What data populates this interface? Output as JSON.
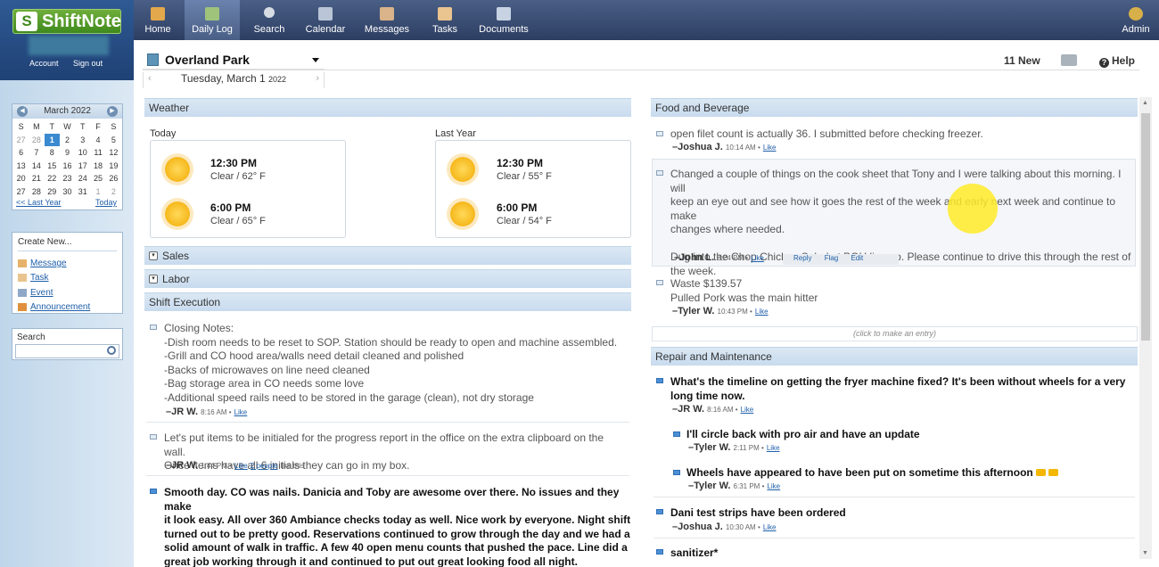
{
  "brand": {
    "name": "ShiftNote"
  },
  "account": {
    "account_label": "Account",
    "signout_label": "Sign out"
  },
  "nav": {
    "home": "Home",
    "daily_log": "Daily Log",
    "search": "Search",
    "calendar": "Calendar",
    "messages": "Messages",
    "tasks": "Tasks",
    "documents": "Documents",
    "admin": "Admin"
  },
  "calendar": {
    "month": "March 2022",
    "days": [
      "S",
      "M",
      "T",
      "W",
      "T",
      "F",
      "S"
    ],
    "weeks": [
      [
        "27",
        "28",
        "1",
        "2",
        "3",
        "4",
        "5"
      ],
      [
        "6",
        "7",
        "8",
        "9",
        "10",
        "11",
        "12"
      ],
      [
        "13",
        "14",
        "15",
        "16",
        "17",
        "18",
        "19"
      ],
      [
        "20",
        "21",
        "22",
        "23",
        "24",
        "25",
        "26"
      ],
      [
        "27",
        "28",
        "29",
        "30",
        "31",
        "1",
        "2"
      ]
    ],
    "last_year": "<< Last Year",
    "today": "Today"
  },
  "create_new": {
    "title": "Create New...",
    "items": [
      "Message",
      "Task",
      "Event",
      "Announcement"
    ]
  },
  "search": {
    "title": "Search",
    "placeholder": ""
  },
  "header": {
    "location": "Overland Park",
    "date": "Tuesday, March 1",
    "year": "2022",
    "new_count": "11 New",
    "help": "Help"
  },
  "weather": {
    "title": "Weather",
    "today_label": "Today",
    "last_year_label": "Last Year",
    "today": [
      {
        "time": "12:30 PM",
        "cond": "Clear / 62° F"
      },
      {
        "time": "6:00 PM",
        "cond": "Clear / 65° F"
      }
    ],
    "last_year": [
      {
        "time": "12:30 PM",
        "cond": "Clear / 55° F"
      },
      {
        "time": "6:00 PM",
        "cond": "Clear / 54° F"
      }
    ]
  },
  "sections": {
    "sales": "Sales",
    "labor": "Labor",
    "shift_execution": "Shift Execution",
    "food_beverage": "Food and Beverage",
    "repair": "Repair and Maintenance"
  },
  "shift_entries": [
    {
      "lines": [
        "Closing Notes:",
        "-Dish room needs to be reset to SOP. Station should be ready to open and machine assembled.",
        "-Grill and CO hood area/walls need detail cleaned and polished",
        "-Backs of microwaves on line need cleaned",
        "-Bag storage area in CO needs some love",
        "-Additional speed rails need to be stored in the garage (clean), not dry storage"
      ],
      "author": "–JR W.",
      "time": "8:16 AM •",
      "like": "Like"
    },
    {
      "lines": [
        "Let's put items to be initialed for the progress report in the office on the extra clipboard on the wall.",
        "Once items have all 6 initials they can go in my box."
      ],
      "author": "–JR W.",
      "time": "1:44 PM •",
      "like": "Like",
      "likers_link": "2 people",
      "likers_text": "like this"
    },
    {
      "lines": [
        "Smooth day. CO was nails. Danicia and Toby are awesome over there. No issues and they make",
        "it look easy. All over 360 Ambiance checks today as well. Nice work by everyone. Night shift",
        "turned out to be pretty good. Reservations continued to grow through the day and we had a",
        "solid amount of walk in traffic. A few 40 open menu counts that pushed the pace. Line did a",
        "great job working through it and continued to put out great looking food all night."
      ]
    }
  ],
  "food_entries": [
    {
      "lines": [
        "open filet count is actually 36. I submitted before checking freezer."
      ],
      "author": "–Joshua J.",
      "time": "10:14 AM •",
      "like": "Like"
    },
    {
      "lines": [
        "Changed a couple of things on the cook sheet that Tony and I were talking about this morning. I will",
        "keep an eye out and see how it goes the rest of the week and early next week and continue to make",
        "changes where needed.",
        "",
        "Dug into the Chop Chicken Salad at BOH line up. Please continue to drive this through the rest of",
        "the week."
      ],
      "author": "–John L.",
      "time": "8:24 PM •",
      "like": "Like",
      "actions": [
        "Reply",
        "Flag",
        "Edit"
      ]
    },
    {
      "lines": [
        "Waste $139.57",
        "Pulled Pork was the main hitter"
      ],
      "author": "–Tyler W.",
      "time": "10:43 PM •",
      "like": "Like"
    }
  ],
  "entry_prompt": "(click to make an entry)",
  "repair_entries": [
    {
      "lines": [
        "What's the timeline on getting the fryer machine fixed? It's been without wheels for a very",
        "long time now."
      ],
      "author": "–JR W.",
      "time": "8:16 AM •",
      "like": "Like"
    },
    {
      "lines": [
        "I'll circle back with pro air and have an update"
      ],
      "author": "–Tyler W.",
      "time": "2:11 PM •",
      "like": "Like"
    },
    {
      "lines": [
        "Wheels have appeared to have been put on sometime this afternoon"
      ],
      "author": "–Tyler W.",
      "time": "6:31 PM •",
      "like": "Like"
    },
    {
      "lines": [
        "Dani test strips have been ordered"
      ],
      "author": "–Joshua J.",
      "time": "10:30 AM •",
      "like": "Like"
    },
    {
      "lines": [
        "sanitizer*"
      ]
    }
  ],
  "colors": {
    "accent": "#3a8ad0",
    "link": "#1f5fa9",
    "brand_green": "#3f8a1d"
  }
}
